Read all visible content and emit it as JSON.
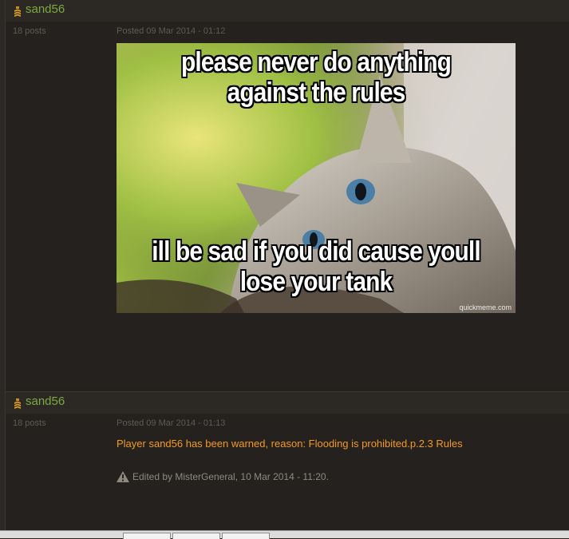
{
  "posts": [
    {
      "author": "sand56",
      "post_count": "18 posts",
      "posted": "Posted 09 Mar 2014 - 01:12",
      "meme": {
        "top_text": "please never do anything against the rules",
        "bottom_text": "ill be sad if you did cause youll lose your tank",
        "watermark": "quickmeme.com"
      }
    },
    {
      "author": "sand56",
      "post_count": "18 posts",
      "posted": "Posted 09 Mar 2014 - 01:13",
      "message": "Player sand56 has been warned, reason: Flooding is prohibited.p.2.3 Rules",
      "edited": "Edited by MisterGeneral, 10 Mar 2014 - 11:20."
    }
  ],
  "colors": {
    "author": "#7da842",
    "warning_text": "#f39a21",
    "muted_text": "#5f5a53",
    "background": "#221f1c"
  },
  "icons": [
    "rank-chevron-icon",
    "warning-triangle-icon"
  ]
}
